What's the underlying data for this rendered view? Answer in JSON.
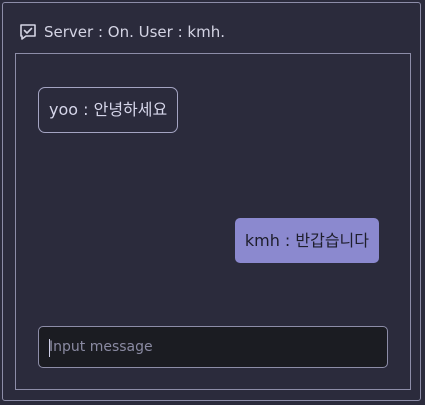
{
  "header": {
    "status_text": "Server : On. User : kmh.",
    "icon": "chat-check-icon"
  },
  "messages": [
    {
      "sender": "yoo",
      "text": "yoo : 안녕하세요",
      "self": false
    },
    {
      "sender": "kmh",
      "text": "kmh : 반갑습니다",
      "self": true
    }
  ],
  "input": {
    "placeholder": "Input message",
    "value": ""
  },
  "colors": {
    "background": "#2b2b3c",
    "border": "#8d8da8",
    "self_bubble": "#8b89cf",
    "input_bg": "#1b1c22"
  }
}
